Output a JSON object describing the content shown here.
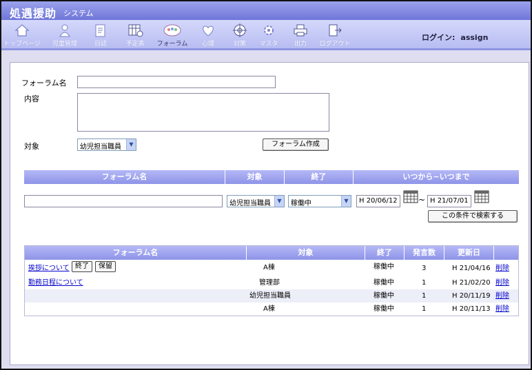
{
  "app": {
    "title": "処遇援助",
    "subtitle": "システム"
  },
  "toolbar": {
    "items": [
      {
        "label": "トップページ",
        "icon": "home-icon"
      },
      {
        "label": "児童管理",
        "icon": "child-icon"
      },
      {
        "label": "日誌",
        "icon": "diary-icon"
      },
      {
        "label": "予定表",
        "icon": "schedule-icon"
      },
      {
        "label": "フォーラム",
        "icon": "forum-icon"
      },
      {
        "label": "心理",
        "icon": "heart-icon"
      },
      {
        "label": "対策",
        "icon": "target-icon"
      },
      {
        "label": "マスタ",
        "icon": "gear-icon"
      },
      {
        "label": "出力",
        "icon": "printer-icon"
      },
      {
        "label": "ログアウト",
        "icon": "logout-icon"
      }
    ]
  },
  "login": {
    "label": "ログイン:",
    "user": "assign"
  },
  "form": {
    "name_label": "フォーラム名",
    "name_value": "",
    "content_label": "内容",
    "content_value": "",
    "target_label": "対象",
    "target_value": "幼児担当職員",
    "create_button": "フォーラム作成"
  },
  "search": {
    "headers": [
      "フォーラム名",
      "対象",
      "終了",
      "いつから~いつまで"
    ],
    "name_value": "",
    "target_value": "幼児担当職員",
    "status_value": "稼働中",
    "date_from": "H 20/06/12",
    "tilde": "~",
    "date_to": "H 21/07/01",
    "search_button": "この条件で検索する"
  },
  "results": {
    "headers": [
      "フォーラム名",
      "対象",
      "終了",
      "発言数",
      "更新日",
      ""
    ],
    "rows": [
      {
        "name": "挨拶について",
        "end_btn": "終了",
        "hold_btn": "保留",
        "target": "A棟",
        "status": "稼働中",
        "count": "3",
        "updated": "H 21/04/16",
        "delete": "削除"
      },
      {
        "name": "勤務日程について",
        "target": "管理部",
        "status": "稼働中",
        "count": "1",
        "updated": "H 21/02/20",
        "delete": "削除"
      },
      {
        "name": "",
        "target": "幼児担当職員",
        "status": "稼働中",
        "count": "1",
        "updated": "H 20/11/19",
        "delete": "削除"
      },
      {
        "name": "",
        "target": "A棟",
        "status": "稼働中",
        "count": "1",
        "updated": "H 20/11/13",
        "delete": "削除"
      }
    ]
  },
  "colors": {
    "header": "#8e94e8",
    "toolbar": "#b8bdf2",
    "link": "#0000cc"
  }
}
